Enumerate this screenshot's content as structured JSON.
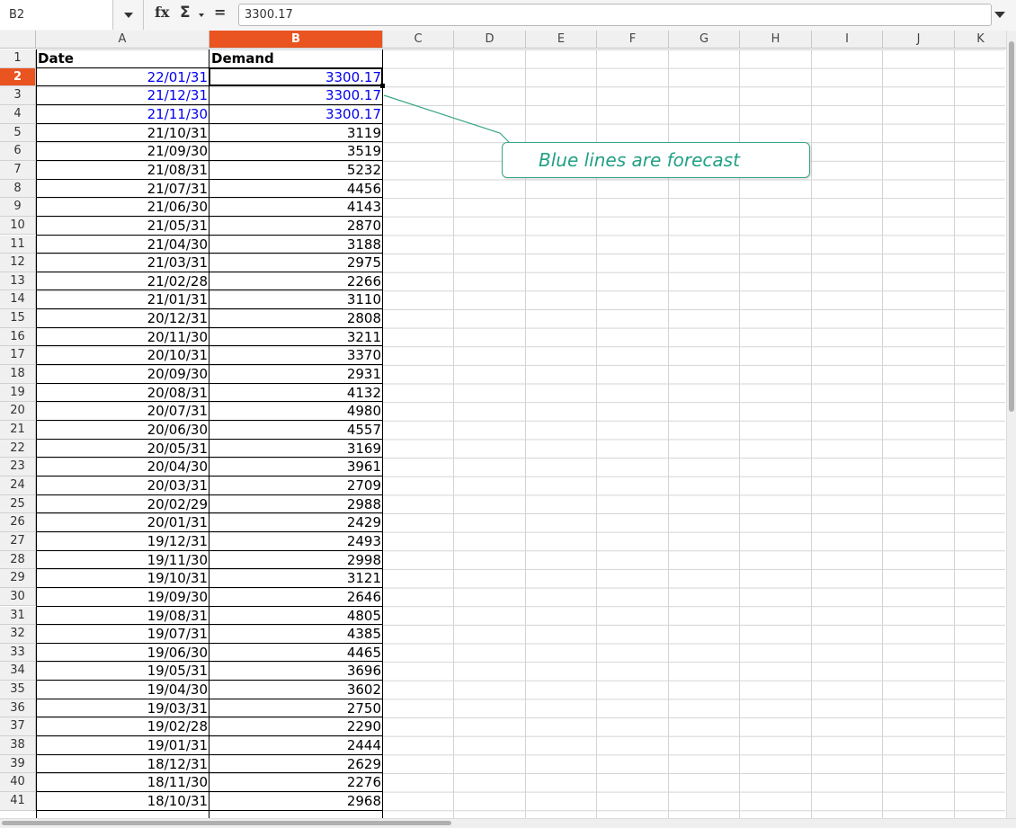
{
  "formula_bar": {
    "name_box": "B2",
    "fx_icon": "fx",
    "sigma_icon": "Σ",
    "equals_icon": "=",
    "content": "3300.17"
  },
  "columns": [
    "A",
    "B",
    "C",
    "D",
    "E",
    "F",
    "G",
    "H",
    "I",
    "J",
    "K"
  ],
  "selected_column": "B",
  "selected_row": 2,
  "rows": [
    {
      "n": "1",
      "a": "Date",
      "b": "Demand",
      "kind": "header"
    },
    {
      "n": "2",
      "a": "22/01/31",
      "b": "3300.17",
      "kind": "forecast"
    },
    {
      "n": "3",
      "a": "21/12/31",
      "b": "3300.17",
      "kind": "forecast"
    },
    {
      "n": "4",
      "a": "21/11/30",
      "b": "3300.17",
      "kind": "forecast"
    },
    {
      "n": "5",
      "a": "21/10/31",
      "b": "3119",
      "kind": "actual"
    },
    {
      "n": "6",
      "a": "21/09/30",
      "b": "3519",
      "kind": "actual"
    },
    {
      "n": "7",
      "a": "21/08/31",
      "b": "5232",
      "kind": "actual"
    },
    {
      "n": "8",
      "a": "21/07/31",
      "b": "4456",
      "kind": "actual"
    },
    {
      "n": "9",
      "a": "21/06/30",
      "b": "4143",
      "kind": "actual"
    },
    {
      "n": "10",
      "a": "21/05/31",
      "b": "2870",
      "kind": "actual"
    },
    {
      "n": "11",
      "a": "21/04/30",
      "b": "3188",
      "kind": "actual"
    },
    {
      "n": "12",
      "a": "21/03/31",
      "b": "2975",
      "kind": "actual"
    },
    {
      "n": "13",
      "a": "21/02/28",
      "b": "2266",
      "kind": "actual"
    },
    {
      "n": "14",
      "a": "21/01/31",
      "b": "3110",
      "kind": "actual"
    },
    {
      "n": "15",
      "a": "20/12/31",
      "b": "2808",
      "kind": "actual"
    },
    {
      "n": "16",
      "a": "20/11/30",
      "b": "3211",
      "kind": "actual"
    },
    {
      "n": "17",
      "a": "20/10/31",
      "b": "3370",
      "kind": "actual"
    },
    {
      "n": "18",
      "a": "20/09/30",
      "b": "2931",
      "kind": "actual"
    },
    {
      "n": "19",
      "a": "20/08/31",
      "b": "4132",
      "kind": "actual"
    },
    {
      "n": "20",
      "a": "20/07/31",
      "b": "4980",
      "kind": "actual"
    },
    {
      "n": "21",
      "a": "20/06/30",
      "b": "4557",
      "kind": "actual"
    },
    {
      "n": "22",
      "a": "20/05/31",
      "b": "3169",
      "kind": "actual"
    },
    {
      "n": "23",
      "a": "20/04/30",
      "b": "3961",
      "kind": "actual"
    },
    {
      "n": "24",
      "a": "20/03/31",
      "b": "2709",
      "kind": "actual"
    },
    {
      "n": "25",
      "a": "20/02/29",
      "b": "2988",
      "kind": "actual"
    },
    {
      "n": "26",
      "a": "20/01/31",
      "b": "2429",
      "kind": "actual"
    },
    {
      "n": "27",
      "a": "19/12/31",
      "b": "2493",
      "kind": "actual"
    },
    {
      "n": "28",
      "a": "19/11/30",
      "b": "2998",
      "kind": "actual"
    },
    {
      "n": "29",
      "a": "19/10/31",
      "b": "3121",
      "kind": "actual"
    },
    {
      "n": "30",
      "a": "19/09/30",
      "b": "2646",
      "kind": "actual"
    },
    {
      "n": "31",
      "a": "19/08/31",
      "b": "4805",
      "kind": "actual"
    },
    {
      "n": "32",
      "a": "19/07/31",
      "b": "4385",
      "kind": "actual"
    },
    {
      "n": "33",
      "a": "19/06/30",
      "b": "4465",
      "kind": "actual"
    },
    {
      "n": "34",
      "a": "19/05/31",
      "b": "3696",
      "kind": "actual"
    },
    {
      "n": "35",
      "a": "19/04/30",
      "b": "3602",
      "kind": "actual"
    },
    {
      "n": "36",
      "a": "19/03/31",
      "b": "2750",
      "kind": "actual"
    },
    {
      "n": "37",
      "a": "19/02/28",
      "b": "2290",
      "kind": "actual"
    },
    {
      "n": "38",
      "a": "19/01/31",
      "b": "2444",
      "kind": "actual"
    },
    {
      "n": "39",
      "a": "18/12/31",
      "b": "2629",
      "kind": "actual"
    },
    {
      "n": "40",
      "a": "18/11/30",
      "b": "2276",
      "kind": "actual"
    },
    {
      "n": "41",
      "a": "18/10/31",
      "b": "2968",
      "kind": "actual"
    }
  ],
  "comment": {
    "text": "Blue lines are forecast"
  },
  "colors": {
    "forecast": "#0000ee",
    "selection": "#e95420",
    "comment": "#22a085"
  }
}
